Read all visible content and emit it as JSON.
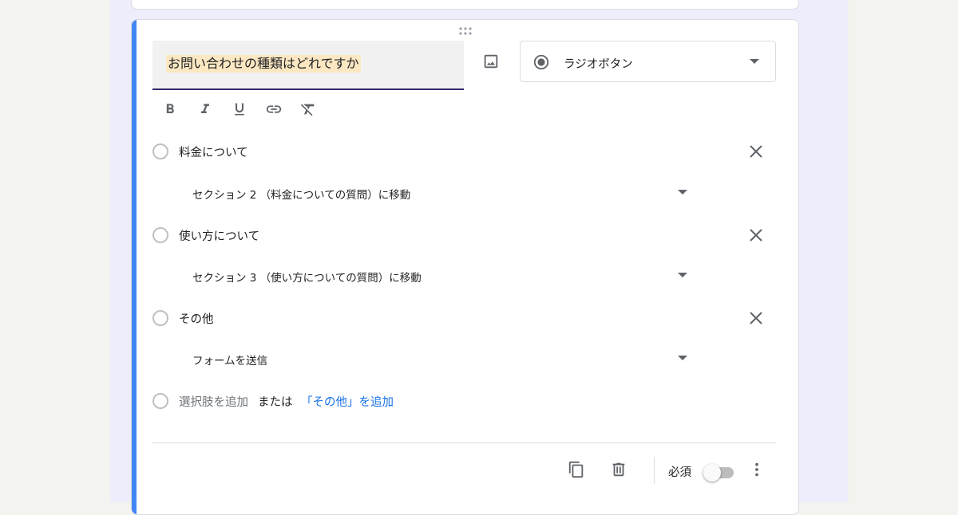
{
  "question": {
    "title": "お問い合わせの種類はどれですか",
    "type_label": "ラジオボタン"
  },
  "format_icons": [
    "bold-icon",
    "italic-icon",
    "underline-icon",
    "link-icon",
    "clear-format-icon"
  ],
  "options": [
    {
      "label": "料金について",
      "goto": "セクション 2 （料金についての質問）に移動"
    },
    {
      "label": "使い方について",
      "goto": "セクション 3 （使い方についての質問）に移動"
    },
    {
      "label": "その他",
      "goto": "フォームを送信"
    }
  ],
  "add_option": {
    "add_label": "選択肢を追加",
    "or_label": "または",
    "add_other_label": "「その他」を追加"
  },
  "footer": {
    "required_label": "必須",
    "required_on": false
  },
  "colors": {
    "accent": "#4285f4",
    "link": "#1a73e8",
    "highlight": "#fbe8c2"
  }
}
